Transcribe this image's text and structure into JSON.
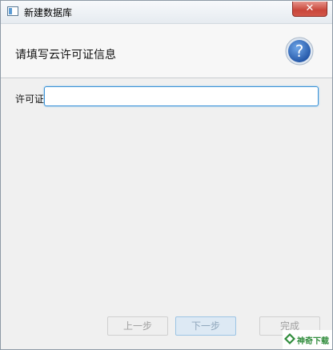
{
  "window": {
    "title": "新建数据库"
  },
  "titlebar": {
    "close_symbol": "✕"
  },
  "header": {
    "title": "请填写云许可证信息",
    "help_symbol": "?"
  },
  "form": {
    "license_label": "许可证",
    "license_value": "",
    "license_placeholder": ""
  },
  "buttons": {
    "prev_label": "上一步",
    "next_label": "下一步",
    "finish_label": "完成"
  },
  "watermark": {
    "text": "神奇下载"
  },
  "colors": {
    "accent": "#3b93d8",
    "help_icon": "#2f6fc4",
    "close_button": "#c9463a",
    "watermark": "#2e8b3a"
  },
  "icons": {
    "app": "app-window-icon",
    "help": "help-question-icon",
    "close": "close-icon",
    "watermark": "leaf-logo-icon"
  }
}
